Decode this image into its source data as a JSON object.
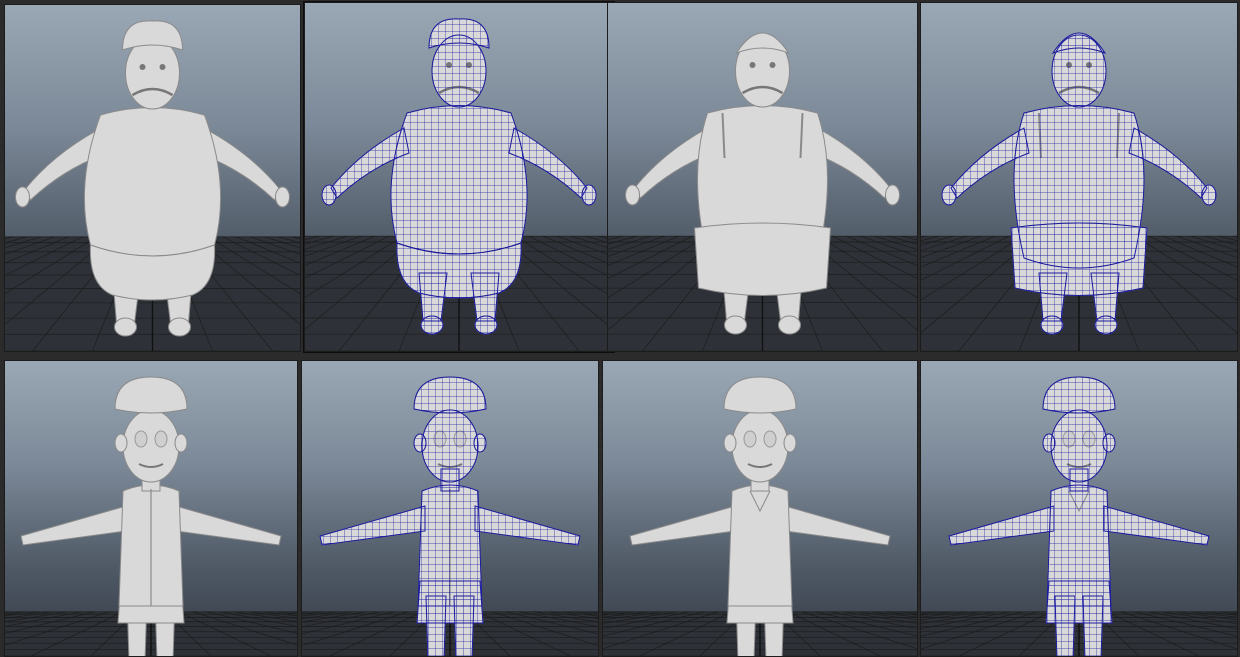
{
  "viewports": [
    {
      "character": "mustache-man",
      "mode": "smooth-shaded",
      "wireframe_color": ""
    },
    {
      "character": "mustache-man",
      "mode": "wireframe-on-shaded",
      "wireframe_color": "#1a1aa0"
    },
    {
      "character": "mustache-man-vest",
      "mode": "smooth-shaded",
      "wireframe_color": ""
    },
    {
      "character": "mustache-man-vest",
      "mode": "wireframe-on-shaded",
      "wireframe_color": "#1a1aa0"
    },
    {
      "character": "boy-shirt",
      "mode": "smooth-shaded",
      "wireframe_color": ""
    },
    {
      "character": "boy-shirt",
      "mode": "wireframe-on-shaded",
      "wireframe_color": "#1a1aa0"
    },
    {
      "character": "boy-tshirt",
      "mode": "smooth-shaded",
      "wireframe_color": ""
    },
    {
      "character": "boy-tshirt",
      "mode": "wireframe-on-shaded",
      "wireframe_color": "#1a1aa0"
    }
  ],
  "colors": {
    "background": "#2b2b2b",
    "model": "#d9d9d9",
    "grid": "#1a1a1a",
    "wire": "#1a1aa0",
    "origin_axis": "#3aa94a"
  }
}
